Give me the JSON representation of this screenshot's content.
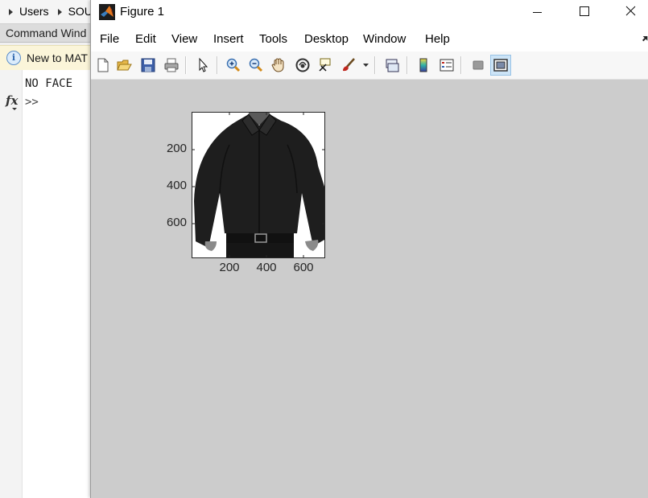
{
  "background": {
    "breadcrumb": [
      "Users",
      "SOU"
    ],
    "command_window_title": "Command Wind",
    "info_bar_text": "New to MAT",
    "command_output": "NO FACE",
    "prompt": ">>",
    "fx_symbol": "fx"
  },
  "figure": {
    "title": "Figure 1",
    "menus": [
      "File",
      "Edit",
      "View",
      "Insert",
      "Tools",
      "Desktop",
      "Window",
      "Help"
    ],
    "toolbar_icons": [
      "new-figure-icon",
      "open-file-icon",
      "save-icon",
      "print-icon",
      "edit-plot-pointer-icon",
      "zoom-in-icon",
      "zoom-out-icon",
      "pan-hand-icon",
      "rotate-3d-icon",
      "data-cursor-icon",
      "brush-icon",
      "link-plot-icon",
      "insert-colorbar-icon",
      "insert-legend-icon",
      "hide-plot-tools-icon",
      "show-plot-tools-icon"
    ],
    "colors": {
      "canvas": "#cccccc",
      "shirt": "#1e1e1e",
      "selected_tool": "#cce4f7"
    },
    "axes": {
      "image_description_hidden": true,
      "y_ticks": [
        "200",
        "400",
        "600"
      ],
      "x_ticks": [
        "200",
        "400",
        "600"
      ]
    }
  }
}
